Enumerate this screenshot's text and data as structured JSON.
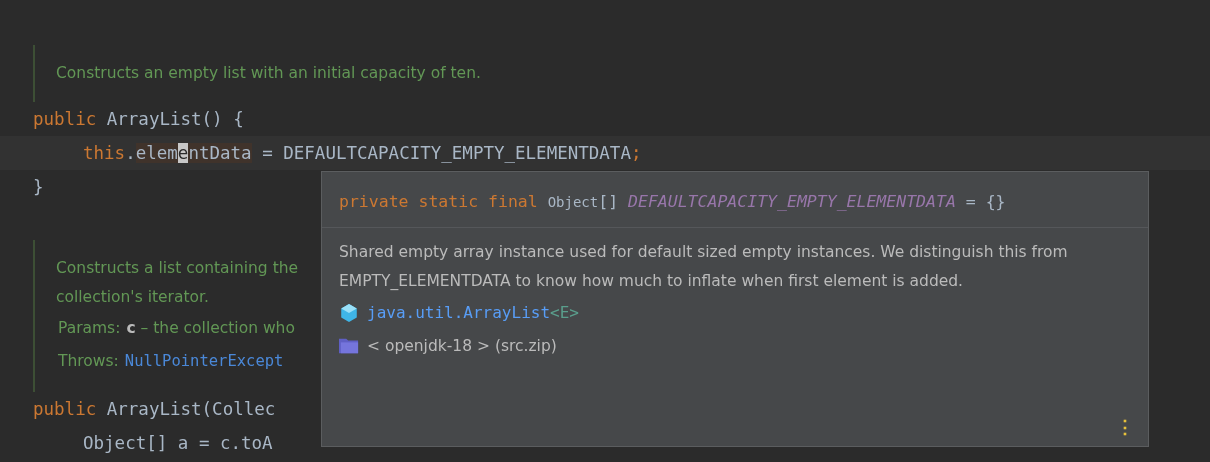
{
  "editor": {
    "blocks": [
      {
        "kind": "doc",
        "lines": [
          "Constructs an empty list with an initial capacity of ten."
        ]
      },
      {
        "kind": "code",
        "tokens": [
          {
            "kind": "keyword",
            "text": "public"
          },
          {
            "kind": "plain",
            "text": " ArrayList() {"
          }
        ]
      },
      {
        "kind": "code",
        "current": true,
        "indent": true,
        "tokens": [
          {
            "kind": "keyword",
            "text": "this"
          },
          {
            "kind": "plain",
            "text": "."
          },
          {
            "kind": "usage",
            "text": "elem"
          },
          {
            "kind": "caret",
            "text": "e"
          },
          {
            "kind": "usage",
            "text": "ntData"
          },
          {
            "kind": "plain",
            "text": " = DEFAULTCAPACITY_EMPTY_ELEMENTDATA"
          },
          {
            "kind": "keyword",
            "text": ";"
          }
        ]
      },
      {
        "kind": "code",
        "tokens": [
          {
            "kind": "plain",
            "text": "}"
          }
        ]
      },
      {
        "kind": "gap"
      },
      {
        "kind": "doc",
        "lines": [
          "Constructs a list containing the",
          "collection's iterator."
        ],
        "tags": [
          {
            "label": "Params:",
            "value": "**c** – the collection who",
            "link": false
          },
          {
            "label": "Throws:",
            "value": "NullPointerExcept",
            "link": true
          }
        ]
      },
      {
        "kind": "code",
        "tokens": [
          {
            "kind": "keyword",
            "text": "public"
          },
          {
            "kind": "plain",
            "text": " ArrayList(Collec"
          }
        ]
      },
      {
        "kind": "code",
        "indent": true,
        "tokens": [
          {
            "kind": "plain",
            "text": "Object[] a = c.toA"
          }
        ]
      }
    ]
  },
  "popup": {
    "signature": [
      {
        "kind": "keyword",
        "text": "private static final "
      },
      {
        "kind": "type",
        "text": "Object"
      },
      {
        "kind": "plain",
        "text": "[] "
      },
      {
        "kind": "constant",
        "text": "DEFAULTCAPACITY_EMPTY_ELEMENTDATA"
      },
      {
        "kind": "plain",
        "text": " = {}"
      }
    ],
    "description": "Shared empty array instance used for default sized empty instances. We distinguish this from EMPTY_ELEMENTDATA to know how much to inflate when first element is added.",
    "class_name": "java.util.ArrayList",
    "type_param": "<E>",
    "library": "< openjdk-18 > (src.zip)",
    "menu": "⋮"
  }
}
